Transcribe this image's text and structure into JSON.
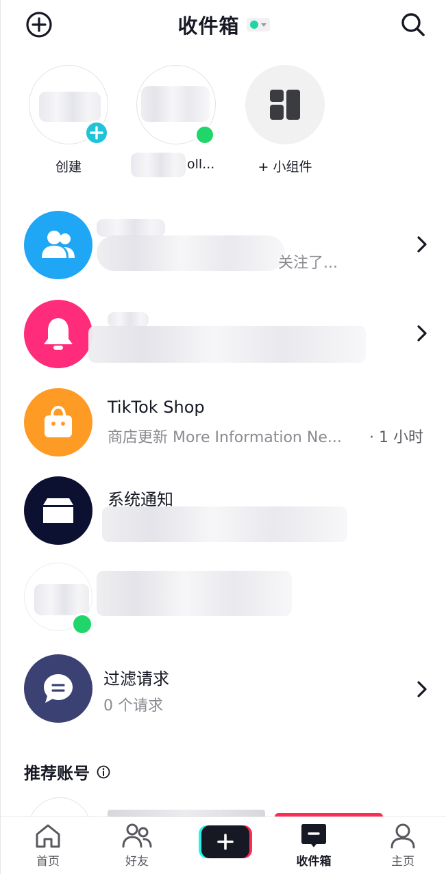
{
  "header": {
    "title": "收件箱",
    "status_color": "#20d5a4",
    "add_icon": "plus-circle-icon",
    "search_icon": "search-icon"
  },
  "stories": [
    {
      "label": "创建",
      "badge": "plus"
    },
    {
      "label": "oll...",
      "badge": "online"
    },
    {
      "label": "+ 小组件",
      "icon": "widget-grid-icon"
    }
  ],
  "rows": {
    "followers": {
      "sub_suffix": "关注了...",
      "color": "#1fa6f5",
      "icon": "users-icon"
    },
    "activity": {
      "color": "#fe2c7a",
      "icon": "bell-icon"
    },
    "shop": {
      "title": "TikTok Shop",
      "sub": "商店更新 More Information Ne...",
      "time": "· 1 小时",
      "color": "#fe9b24",
      "icon": "shopping-bag-icon"
    },
    "system": {
      "title": "系统通知",
      "color": "#0c1031",
      "icon": "inbox-icon"
    },
    "chat": {
      "status_color": "#20d56a"
    },
    "filter": {
      "title": "过滤请求",
      "sub": "0 个请求",
      "color": "#3b4273",
      "icon": "chat-bubble-icon"
    }
  },
  "suggested": {
    "title": "推荐账号",
    "info_icon": "info-icon"
  },
  "bottom_nav": [
    {
      "label": "首页",
      "icon": "home-icon"
    },
    {
      "label": "好友",
      "icon": "friends-icon"
    },
    {
      "label": "",
      "icon": "create-plus-icon"
    },
    {
      "label": "收件箱",
      "icon": "inbox-nav-icon",
      "active": true
    },
    {
      "label": "主页",
      "icon": "profile-icon"
    }
  ]
}
